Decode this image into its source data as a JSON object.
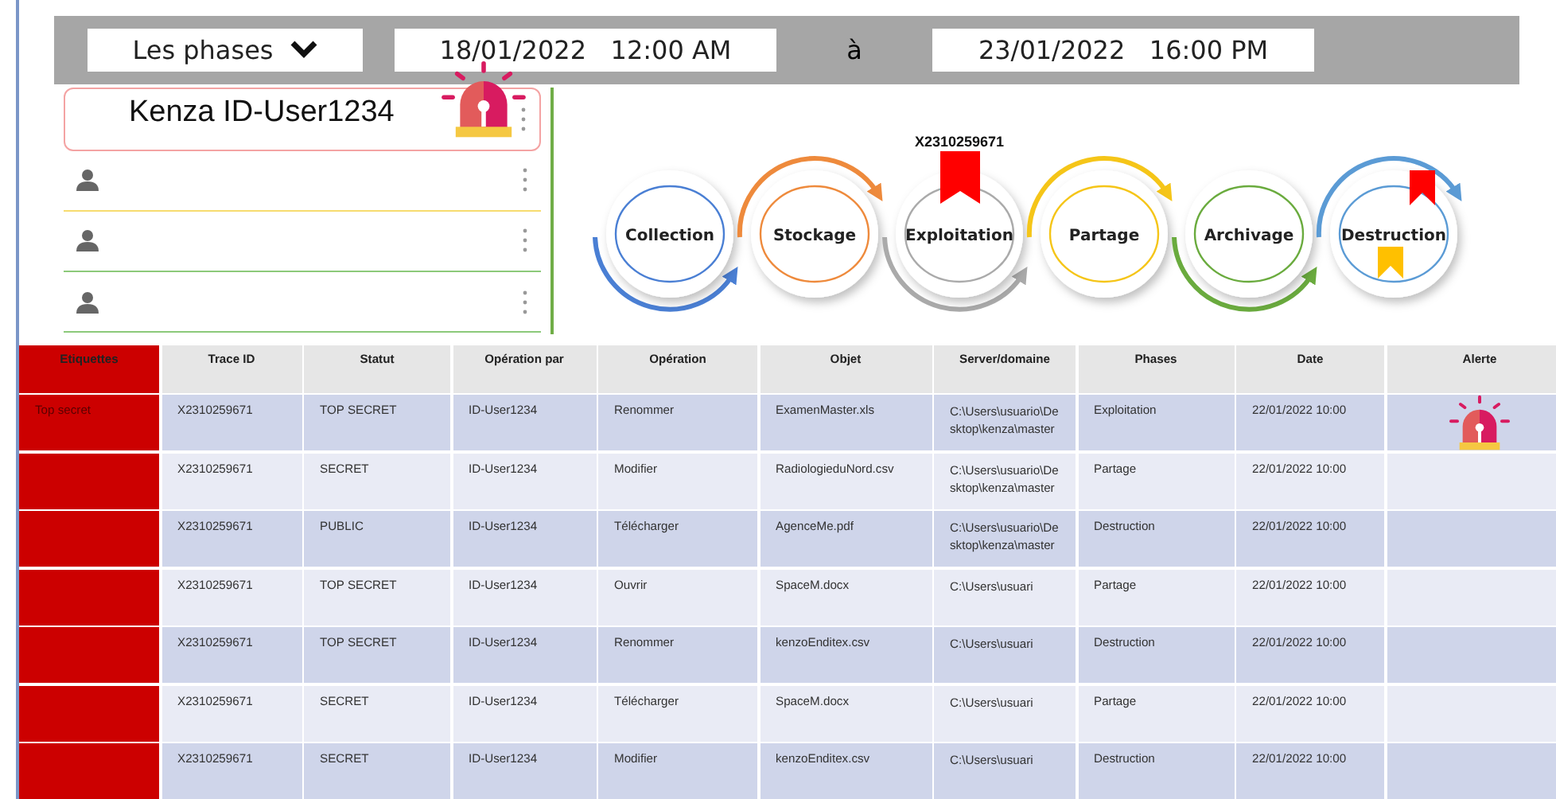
{
  "filters": {
    "phase_dropdown": "Les phases",
    "start": "18/01/2022   12:00 AM",
    "separator": "à",
    "end": "23/01/2022   16:00 PM"
  },
  "users": [
    {
      "kind": "named",
      "name": "Kenza ID-User1234",
      "alert": true,
      "color": "#f4a3a3"
    },
    {
      "kind": "empty",
      "alert": false,
      "color": "#f7dc6f"
    },
    {
      "kind": "empty",
      "alert": false,
      "color": "#8cc97a"
    },
    {
      "kind": "empty",
      "alert": false,
      "color": "#8cc97a"
    }
  ],
  "phases": [
    {
      "label": "Collection",
      "color": "#4a7fd4"
    },
    {
      "label": "Stockage",
      "color": "#ee8a3c"
    },
    {
      "label": "Exploitation",
      "color": "#aaaaaa",
      "bookmarks": [
        {
          "color": "#ff0000",
          "label": "X2310259671"
        }
      ]
    },
    {
      "label": "Partage",
      "color": "#f5c518"
    },
    {
      "label": "Archivage",
      "color": "#6aab3e"
    },
    {
      "label": "Destruction",
      "color": "#5b9bd5",
      "bookmarks": [
        {
          "color": "#ff0000"
        },
        {
          "color": "#ffc000"
        }
      ]
    }
  ],
  "table": {
    "columns": [
      "Etiquettes",
      "Trace ID",
      "Statut",
      "Opération par",
      "Opération",
      "Objet",
      "Server/domaine",
      "Phases",
      "Date",
      "Alerte"
    ],
    "rows": [
      {
        "label": "Top secret",
        "trace_id": "X2310259671",
        "status": "TOP SECRET",
        "by": "ID-User1234",
        "operation": "Renommer",
        "object": "ExamenMaster.xls",
        "server": "C:\\Users\\usuario\\Desktop\\kenza\\master",
        "phase": "Exploitation",
        "date": "22/01/2022 10:00",
        "alert": true
      },
      {
        "trace_id": "X2310259671",
        "status": "SECRET",
        "by": "ID-User1234",
        "operation": "Modifier",
        "object": "RadiologieduNord.csv",
        "server": "C:\\Users\\usuario\\Desktop\\kenza\\master",
        "phase": "Partage",
        "date": "22/01/2022 10:00",
        "alert": false
      },
      {
        "trace_id": "X2310259671",
        "status": "PUBLIC",
        "by": "ID-User1234",
        "operation": "Télécharger",
        "object": "AgenceMe.pdf",
        "server": "C:\\Users\\usuario\\Desktop\\kenza\\master",
        "phase": "Destruction",
        "date": "22/01/2022 10:00",
        "alert": false
      },
      {
        "trace_id": "X2310259671",
        "status": "TOP SECRET",
        "by": "ID-User1234",
        "operation": "Ouvrir",
        "object": "SpaceM.docx",
        "server": "C:\\Users\\usuari",
        "phase": "Partage",
        "date": "22/01/2022 10:00",
        "alert": false
      },
      {
        "trace_id": "X2310259671",
        "status": "TOP SECRET",
        "by": "ID-User1234",
        "operation": "Renommer",
        "object": "kenzoEnditex.csv",
        "server": "C:\\Users\\usuari",
        "phase": "Destruction",
        "date": "22/01/2022 10:00",
        "alert": false
      },
      {
        "trace_id": "X2310259671",
        "status": "SECRET",
        "by": "ID-User1234",
        "operation": "Télécharger",
        "object": "SpaceM.docx",
        "server": "C:\\Users\\usuari",
        "phase": "Partage",
        "date": "22/01/2022 10:00",
        "alert": false
      },
      {
        "trace_id": "X2310259671",
        "status": "SECRET",
        "by": "ID-User1234",
        "operation": "Modifier",
        "object": "kenzoEnditex.csv",
        "server": "C:\\Users\\usuari",
        "phase": "Destruction",
        "date": "22/01/2022 10:00",
        "alert": false
      }
    ]
  }
}
